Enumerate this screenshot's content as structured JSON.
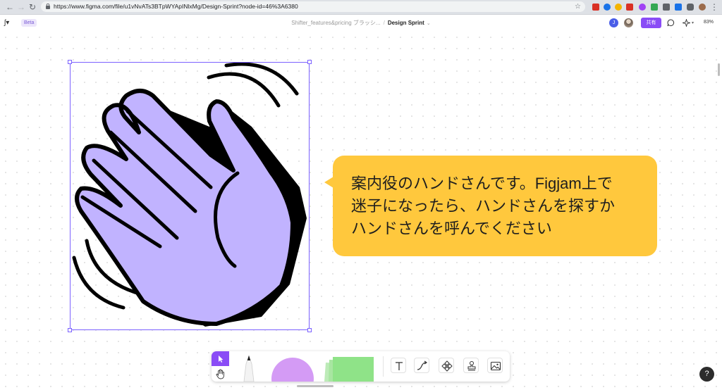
{
  "browser": {
    "url": "https://www.figma.com/file/u1vNvATs3BTpWYApINlxMg/Design-Sprint?node-id=46%3A6380",
    "extension_colors": [
      "#d93025",
      "#1a73e8",
      "#f4b400",
      "#d93025",
      "#a142f4",
      "#34a853",
      "#5f6368",
      "#1a73e8",
      "#5f6368",
      "#0f9d58",
      "#5f6368"
    ]
  },
  "figma": {
    "beta_label": "Beta",
    "breadcrumb_parent": "Shifter_features&pricing ブラッシ...",
    "breadcrumb_current": "Design Sprint",
    "user_initial": "J",
    "share_label": "共有",
    "zoom_level": "83%",
    "help_label": "?"
  },
  "canvas": {
    "bubble_lines": [
      "案内役のハンドさんです。Figjam上で",
      "迷子になったら、ハンドさんを探すか",
      "ハンドさんを呼んでください"
    ],
    "hand_fill": "#c1b3ff",
    "bubble_fill": "#ffc83d",
    "selection_color": "#7b61ff"
  },
  "toolbar": {
    "accent": "#8a4cf6",
    "sticky_color": "#8fe388",
    "shape_color": "#d49bf5"
  }
}
